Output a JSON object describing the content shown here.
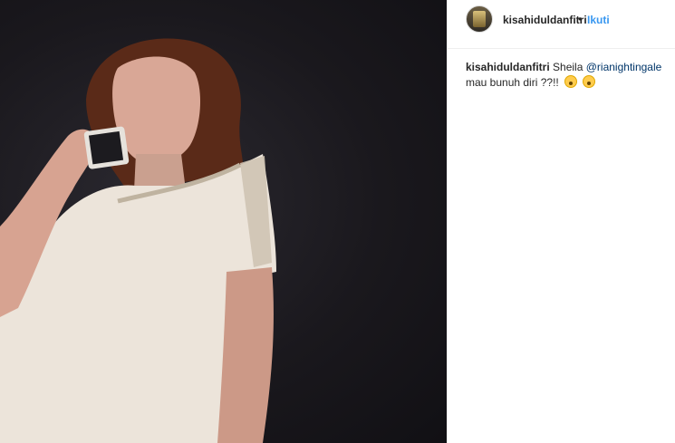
{
  "post": {
    "username": "kisahiduldanfitri",
    "separator": "•",
    "follow_label": "Ikuti"
  },
  "caption": {
    "user": "kisahiduldanfitri",
    "text_before": "Sheila",
    "mention": "@rianightingale",
    "text_after": "mau bunuh diri ??!!",
    "emojis": [
      "face-screaming-in-fear-icon",
      "face-screaming-in-fear-icon"
    ]
  }
}
